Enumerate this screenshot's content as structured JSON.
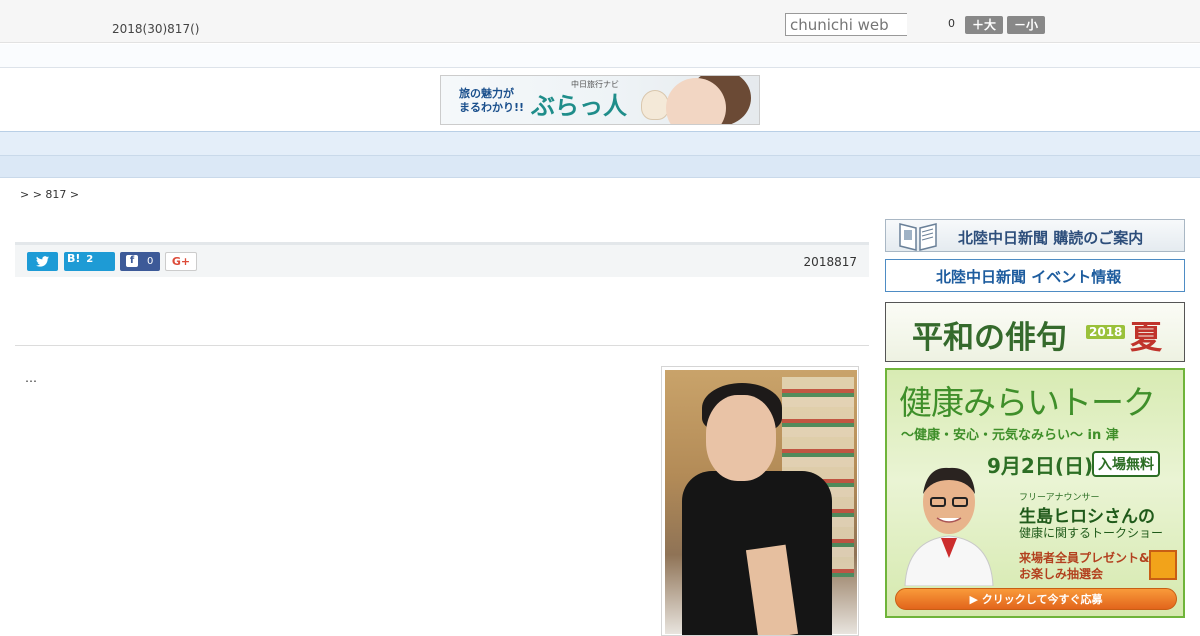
{
  "header": {
    "date": "2018(30)817()",
    "search_placeholder": "chunichi web",
    "counter": "0",
    "font_larger": "＋大",
    "font_smaller": "－小"
  },
  "banner": {
    "line1": "旅の魅力が",
    "line2": "まるわかり!!",
    "brand_small": "中日旅行ナビ",
    "brand": "ぶらっ人"
  },
  "nav": {
    "items": [
      "",
      "",
      "",
      "",
      "",
      "",
      "",
      "",
      ""
    ]
  },
  "breadcrumb": ">  > 817 >",
  "share": {
    "twitter": "",
    "hatena_label": "B!",
    "hatena_count": "2",
    "facebook_count": "0",
    "gplus": "G+"
  },
  "article": {
    "date": "2018817",
    "body_start": "…"
  },
  "sidebar": {
    "ad1": {
      "text": "北陸中日新聞 購読のご案内",
      "icon": "newspaper-book-icon"
    },
    "ad2": {
      "text": "北陸中日新聞 イベント情報"
    },
    "ad3": {
      "title": "平和の俳句",
      "year": "2018",
      "season": "夏"
    },
    "ad4": {
      "title": "健康みらいトーク",
      "subtitle": "～健康・安心・元気なみらい～ in 津",
      "date": "9月2日(日)",
      "admission": "入場無料",
      "role": "フリーアナウンサー",
      "name": "生島ヒロシさんの",
      "topic": "健康に関するトークショー",
      "gift_line1": "来場者全員プレゼント&",
      "gift_line2": "お楽しみ抽選会",
      "cta": "▶ クリックして今すぐ応募"
    }
  },
  "colors": {
    "nav_bg": "#e4eef9",
    "twitter": "#1d9bd6",
    "facebook": "#3d5a98",
    "ad_green": "#3f8f2a"
  }
}
